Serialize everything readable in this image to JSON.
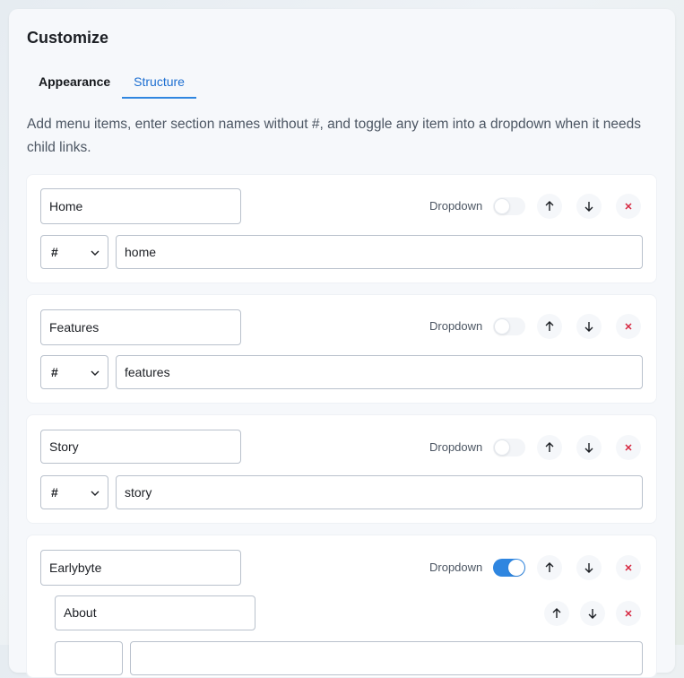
{
  "title": "Customize",
  "tabs": [
    {
      "label": "Appearance",
      "active": false
    },
    {
      "label": "Structure",
      "active": true
    }
  ],
  "description": "Add menu items, enter section names without #, and toggle any item into a dropdown when it needs child links.",
  "dropdown_label": "Dropdown",
  "colors": {
    "accent": "#2f86e0",
    "remove": "#d6263f"
  },
  "menu_items": [
    {
      "label": "Home",
      "link_type": "#",
      "target": "home",
      "dropdown": false
    },
    {
      "label": "Features",
      "link_type": "#",
      "target": "features",
      "dropdown": false
    },
    {
      "label": "Story",
      "link_type": "#",
      "target": "story",
      "dropdown": false
    },
    {
      "label": "Earlybyte",
      "dropdown": true,
      "children": [
        {
          "label": "About"
        }
      ]
    }
  ]
}
